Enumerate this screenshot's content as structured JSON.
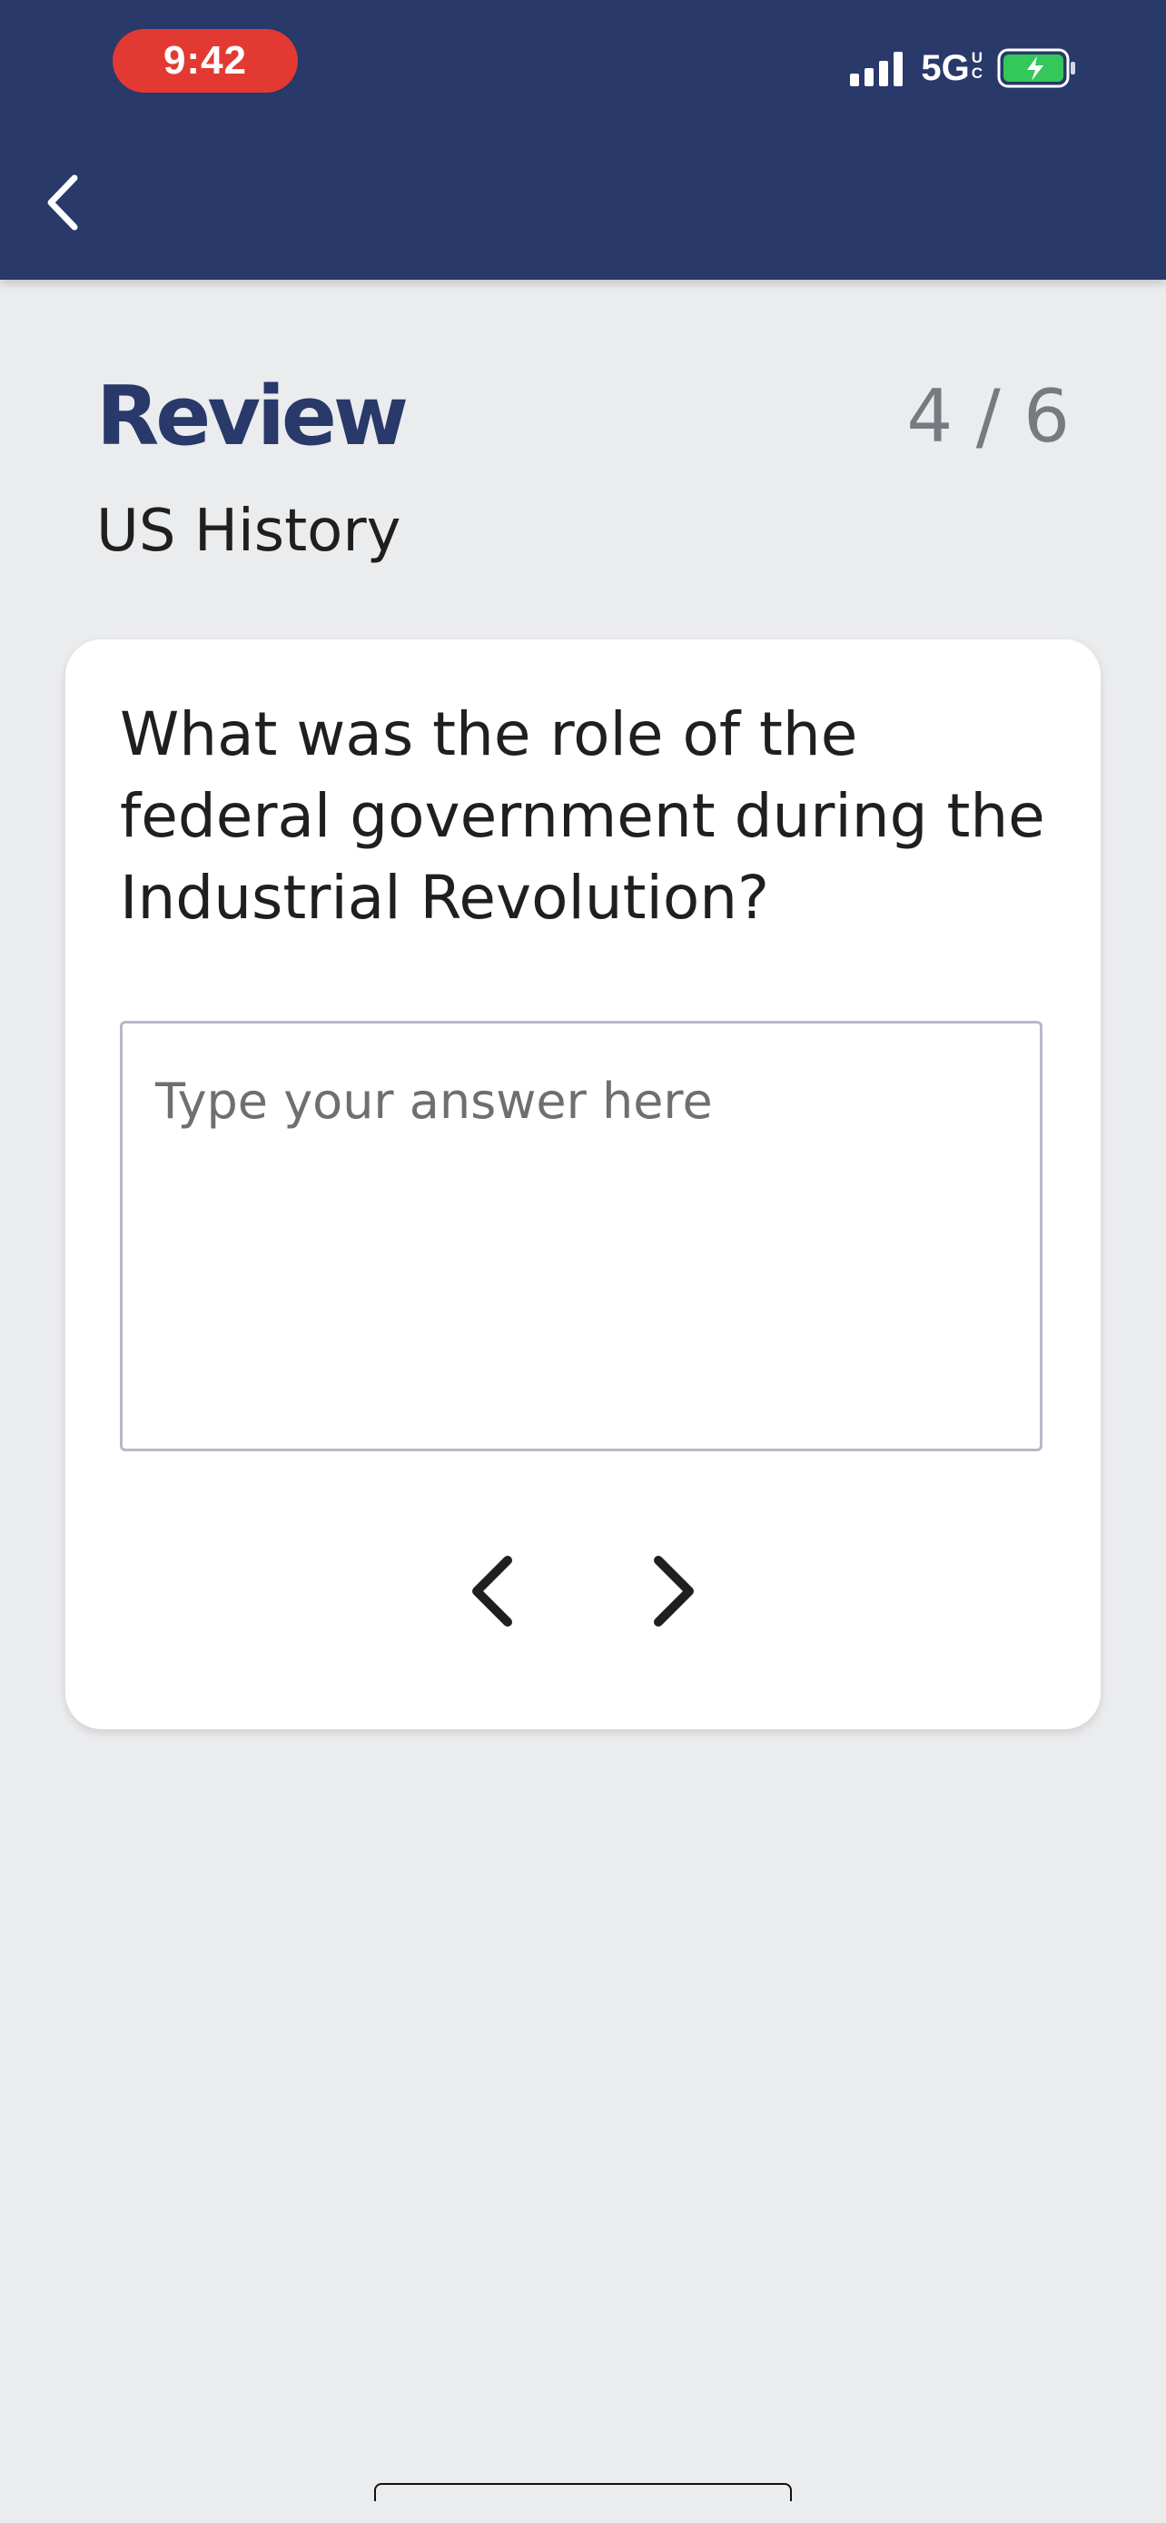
{
  "status_bar": {
    "time": "9:42",
    "network": "5G",
    "network_suffix_top": "U",
    "network_suffix_bottom": "C",
    "battery_state": "charging",
    "signal_bars": 4
  },
  "header": {
    "back_icon": "chevron-left-icon"
  },
  "page": {
    "title": "Review",
    "progress": "4 / 6",
    "subtitle": "US History"
  },
  "card": {
    "question": "What was the role of the federal government during the Industrial Revolution?",
    "answer_placeholder": "Type your answer here",
    "answer_value": "",
    "prev_icon": "chevron-left-icon",
    "next_icon": "chevron-right-icon"
  },
  "colors": {
    "header_bg": "#28396a",
    "title": "#28396a",
    "time_pill": "#e23a33",
    "battery_fill": "#34c759",
    "page_bg": "#ebecee"
  }
}
